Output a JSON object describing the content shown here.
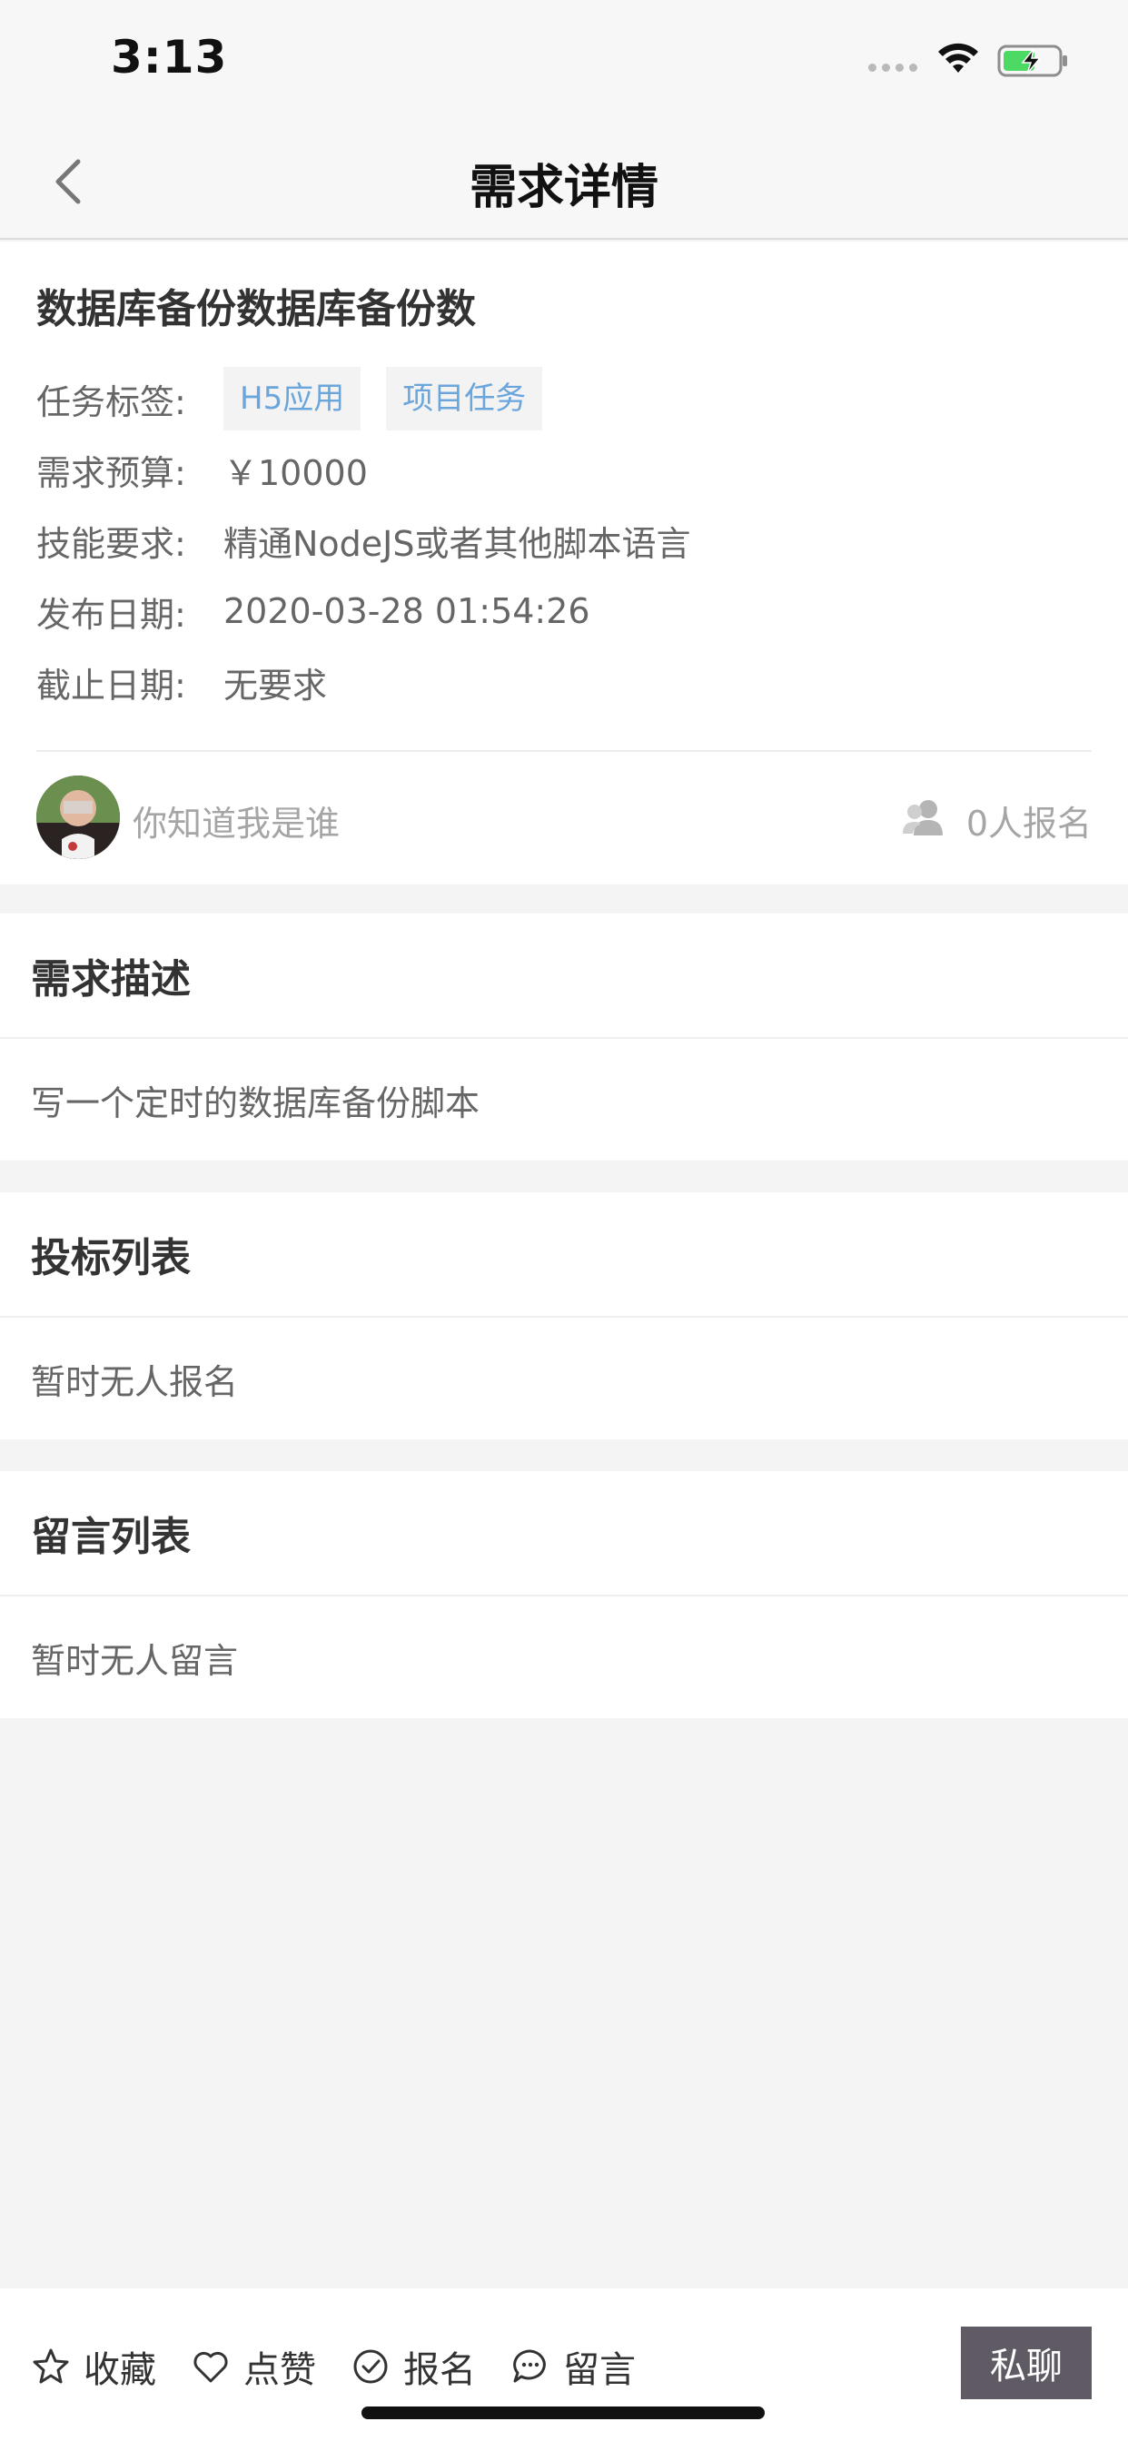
{
  "status_bar": {
    "time": "3:13"
  },
  "nav": {
    "title": "需求详情"
  },
  "task": {
    "title": "数据库备份数据库备份数",
    "tags_label": "任务标签:",
    "tags": [
      "H5应用",
      "项目任务"
    ],
    "budget_label": "需求预算:",
    "budget_value": "￥10000",
    "skill_label": "技能要求:",
    "skill_value": "精通NodeJS或者其他脚本语言",
    "publish_label": "发布日期:",
    "publish_value": "2020-03-28 01:54:26",
    "deadline_label": "截止日期:",
    "deadline_value": "无要求",
    "publisher_name": "你知道我是谁",
    "applicant_count": "0人报名"
  },
  "sections": {
    "description": {
      "title": "需求描述",
      "body": "写一个定时的数据库备份脚本"
    },
    "bids": {
      "title": "投标列表",
      "body": "暂时无人报名"
    },
    "comments": {
      "title": "留言列表",
      "body": "暂时无人留言"
    }
  },
  "toolbar": {
    "favorite_label": "收藏",
    "like_label": "点赞",
    "apply_label": "报名",
    "comment_label": "留言",
    "chat_label": "私聊"
  },
  "colors": {
    "tag_text": "#6aa5dc",
    "chat_button": "#5f5a64",
    "battery_green": "#4cd964"
  },
  "icons": [
    "wifi-icon",
    "battery-icon",
    "back-chevron-icon",
    "avatar",
    "user-group-icon",
    "star-icon",
    "heart-icon",
    "check-circle-icon",
    "chat-bubble-icon"
  ]
}
